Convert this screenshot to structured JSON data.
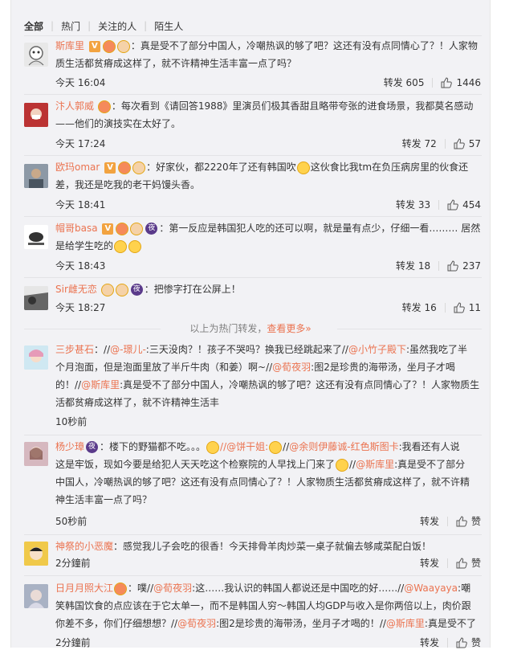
{
  "tabs": [
    "全部",
    "热门",
    "关注的人",
    "陌生人"
  ],
  "hot_comments": [
    {
      "username": "斯库里",
      "text": "：真是受不了部分中国人，冷嘲热讽的够了吧？这还有没有点同情心了？！人家物质生活都贫瘠成这样了，就不许精神生活丰富一点了吗？",
      "time": "今天 16:04",
      "repost_label": "转发",
      "repost_count": "605",
      "like_count": "1446"
    },
    {
      "username": "汴人郭威",
      "text": "：每次看到《请回答1988》里演员们极其香甜且略带夸张的进食场景，我都莫名感动——他们的演技实在太好了。",
      "time": "今天 17:24",
      "repost_label": "转发",
      "repost_count": "72",
      "like_count": "57"
    },
    {
      "username": "欧玛omar",
      "text_a": "：好家伙，都2220年了还有韩国吹",
      "text_b": "这伙食比我tm在负压病房里的伙食还差，我还是吃我的老干妈馒头香。",
      "time": "今天 18:41",
      "repost_label": "转发",
      "repost_count": "33",
      "like_count": "454"
    },
    {
      "username": "帽哥basa",
      "text": "：第一反应是韩国犯人吃的还可以啊，就是量有点少，仔细一看……… 居然是给学生吃的",
      "time": "今天 18:43",
      "repost_label": "转发",
      "repost_count": "18",
      "like_count": "237"
    },
    {
      "username": "Sir雌无恋",
      "text": "：把惨字打在公屏上！",
      "time": "今天 18:27",
      "repost_label": "转发",
      "repost_count": "16",
      "like_count": "11"
    }
  ],
  "hot_banner": {
    "text": "以上为热门转发，",
    "more": "查看更多»"
  },
  "recent_comments": [
    {
      "username": "三步甚石",
      "line": "：//@-珶儿-:三天没肉？！孩子不哭吗？换我已经跳起来了//@小竹子殿下:虽然我吃了半个月泡面，但是泡面里放了半斤牛肉（和姜）啊~//@荀夜羽:图2是珍贵的海带汤，坐月子才喝的！//@斯库里:真是受不了部分中国人，冷嘲热讽的够了吧？这还有没有点同情心了？！人家物质生活都贫瘠成这样了，就不许精神生活丰",
      "l1": "：//@-璟儿-:三天没肉？！孩子不哭吗？换我已经跳起来了//@小竹子殿下:虽然我吃了半",
      "l2": "个月泡面，但是泡面里放了半斤牛肉（和姜）啊~//@荀夜羽:图2是珍贵的海带汤，坐月子才喝",
      "l3": "的！//@斯库里:真是受不了部分中国人，冷嘲热讽的够了吧？这还有没有点同情心了？！人家物质生",
      "l4": "活都贫瘠成这样了，就不许精神生活丰",
      "time": "10秒前"
    },
    {
      "username": "杨少璋",
      "l1": "：楼下的野猫都不吃。。。",
      "l1b": "//@饼干姐:",
      "l1c": "//@余则伊藤诚-红色斯图卡:我看还有人说",
      "l2": "这是牢饭，现如今要是给犯人天天吃这个检察院的人早找上门来了",
      "l2b": "//@斯库里:真是受不了部分",
      "l3": "中国人，冷嘲热讽的够了吧？这还有没有点同情心了？！人家物质生活都贫瘠成这样了，就不许精",
      "l4": "神生活丰富一点了吗？",
      "time": "50秒前",
      "repost_label": "转发",
      "like_label": "赞"
    },
    {
      "username": "神祭的小恶魔",
      "l1": "：感觉我儿子会吃的很香！今天排骨羊肉炒菜一桌子就偏去够咸菜配白饭！",
      "time": "2分鐘前",
      "repost_label": "转发",
      "like_label": "赞"
    },
    {
      "username": "日月月照大江",
      "l1": "：噗//@荀夜羽:这……我认识的韩国人都说还是中国吃的好……//@Waayaya:嘲",
      "l2": "笑韩国饮食的点应该在于它太单一，而不是韩国人穷～韩国人均GDP与收入是你两倍以上，肉价跟",
      "l3": "你差不多，你们仔细想想？//@荀夜羽:图2是珍贵的海带汤，坐月子才喝的！//@斯库里:真是受不了",
      "time": "2分鐘前",
      "repost_label": "转发",
      "like_label": "赞"
    }
  ],
  "colors": {
    "accent": "#eb7350",
    "text": "#333333",
    "muted": "#808080",
    "bg": "#f2f2f5"
  }
}
